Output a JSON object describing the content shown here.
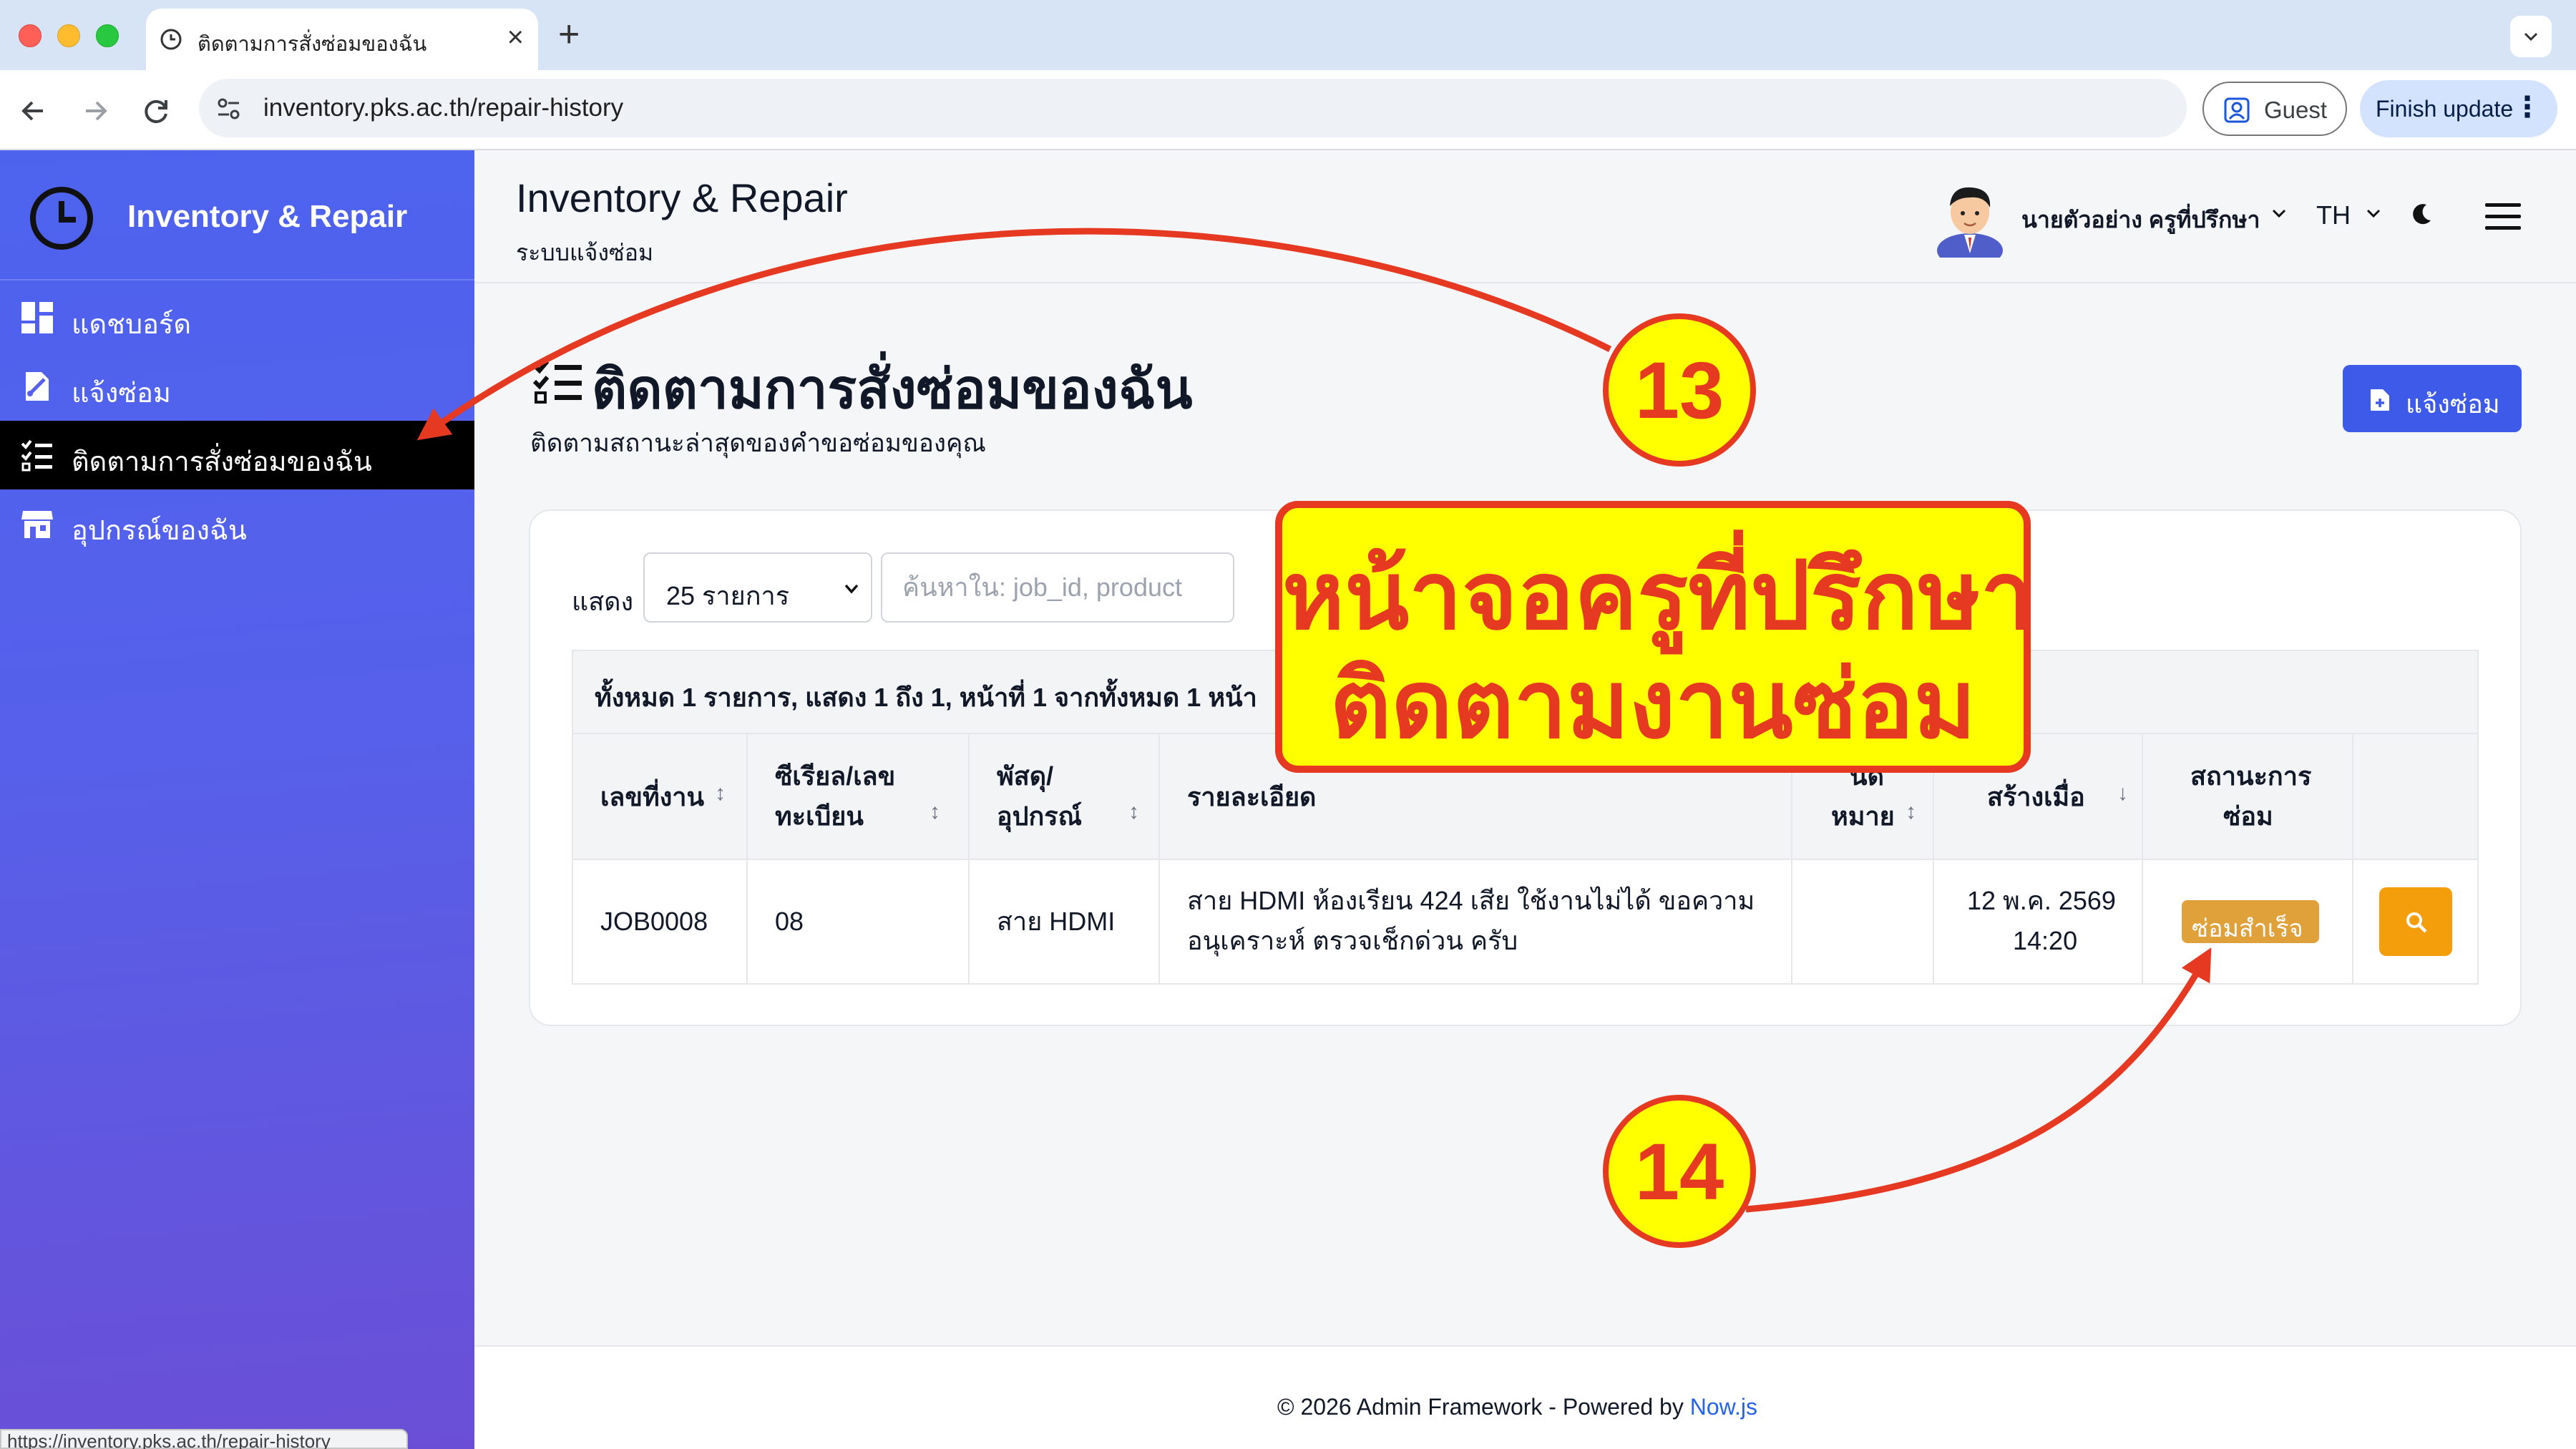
{
  "browser": {
    "tab_title": "ติดตามการสั่งซ่อมของฉัน",
    "url": "inventory.pks.ac.th/repair-history",
    "guest_label": "Guest",
    "finish_update_label": "Finish update",
    "status_url": "https://inventory.pks.ac.th/repair-history"
  },
  "sidebar": {
    "brand": "Inventory & Repair",
    "items": [
      {
        "label": "แดชบอร์ด",
        "icon": "dashboard-icon",
        "active": false
      },
      {
        "label": "แจ้งซ่อม",
        "icon": "repair-request-icon",
        "active": false
      },
      {
        "label": "ติดตามการสั่งซ่อมของฉัน",
        "icon": "checklist-icon",
        "active": true
      },
      {
        "label": "อุปกรณ์ของฉัน",
        "icon": "store-icon",
        "active": false
      }
    ]
  },
  "header": {
    "title": "Inventory & Repair",
    "subtitle": "ระบบแจ้งซ่อม",
    "user_name": "นายตัวอย่าง ครูที่ปรึกษา",
    "language": "TH"
  },
  "page": {
    "title": "ติดตามการสั่งซ่อมของฉัน",
    "description": "ติดตามสถานะล่าสุดของคำขอซ่อมของคุณ",
    "report_button": "แจ้งซ่อม"
  },
  "controls": {
    "show_label": "แสดง",
    "page_size": "25 รายการ",
    "search_placeholder": "ค้นหาใน: job_id, product"
  },
  "table": {
    "summary": "ทั้งหมด 1 รายการ, แสดง 1 ถึง 1, หน้าที่ 1 จากทั้งหมด 1 หน้า",
    "headers": {
      "job_no": "เลขที่งาน",
      "serial_1": "ซีเรียล/เลข",
      "serial_2": "ทะเบียน",
      "product_1": "พัสดุ/",
      "product_2": "อุปกรณ์",
      "detail": "รายละเอียด",
      "note_1": "นัด",
      "note_2": "หมาย",
      "created": "สร้างเมื่อ",
      "status_1": "สถานะการ",
      "status_2": "ซ่อม"
    },
    "rows": [
      {
        "job_no": "JOB0008",
        "serial": "08",
        "product": "สาย HDMI",
        "detail_1": "สาย HDMI ห้องเรียน 424 เสีย ใช้งานไม่ได้ ขอความ",
        "detail_2": "อนุเคราะห์ ตรวจเช็กด่วน ครับ",
        "note": "",
        "created_date": "12 พ.ค. 2569",
        "created_time": "14:20",
        "status": "ซ่อมสำเร็จ",
        "status_color": "#e0a03a"
      }
    ]
  },
  "footer": {
    "text": "© 2026 Admin Framework - Powered by ",
    "link": "Now.js"
  },
  "annotations": {
    "callout_13": "13",
    "callout_14": "14",
    "box_line_1": "หน้าจอครูที่ปรึกษา",
    "box_line_2": "ติดตามงานซ่อม",
    "color": "#e53922",
    "fill": "#ffff00"
  },
  "colors": {
    "sidebar_start": "#4d63ee",
    "sidebar_end": "#6a4fd6",
    "primary": "#3d5be8",
    "warning": "#f59e0b"
  }
}
